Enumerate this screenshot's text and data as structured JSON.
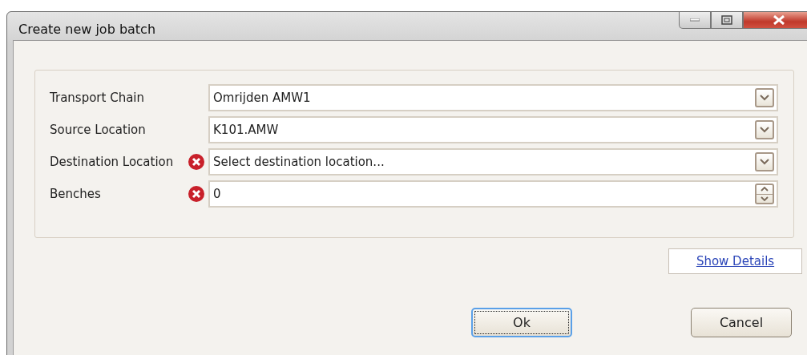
{
  "window": {
    "title": "Create new job batch"
  },
  "fields": [
    {
      "label": "Transport Chain",
      "kind": "dropdown",
      "error": false,
      "value": "Omrijden AMW1"
    },
    {
      "label": "Source Location",
      "kind": "dropdown",
      "error": false,
      "value": "K101.AMW"
    },
    {
      "label": "Destination Location",
      "kind": "dropdown",
      "error": true,
      "placeholder": "Select destination location..."
    },
    {
      "label": "Benches",
      "kind": "spinner",
      "error": true,
      "value": "0"
    }
  ],
  "details_link": "Show Details",
  "buttons": [
    {
      "label": "Ok",
      "focused": true
    },
    {
      "label": "Cancel",
      "focused": false
    }
  ]
}
